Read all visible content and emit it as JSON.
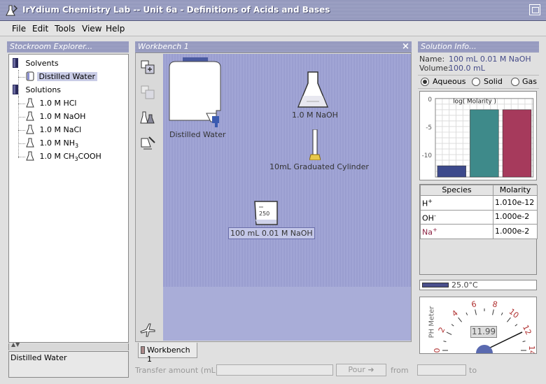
{
  "window": {
    "title": "IrYdium Chemistry Lab -- Unit 6a - Definitions of Acids and Bases"
  },
  "menu": {
    "file": "File",
    "edit": "Edit",
    "tools": "Tools",
    "view": "View",
    "help": "Help"
  },
  "explorer": {
    "header": "Stockroom Explorer...",
    "solvents_label": "Solvents",
    "distilled_water": "Distilled Water",
    "solutions_label": "Solutions",
    "solution_items": [
      "1.0 M HCl",
      "1.0 M NaOH",
      "1.0 M NaCl"
    ],
    "nh3_prefix": "1.0 M NH",
    "nh3_sub": "3",
    "acetic_prefix": "1.0 M CH",
    "acetic_sub": "3",
    "acetic_suffix": "COOH",
    "selected_description": "Distilled Water"
  },
  "workbench": {
    "header": "Workbench 1",
    "close": "×",
    "items": {
      "water_label": "Distilled Water",
      "flask_label": "1.0 M NaOH",
      "cylinder_label": "10mL Graduated Cylinder",
      "beaker_label": "100 mL 0.01 M NaOH",
      "beaker_volume_mark": "250"
    },
    "tab_label": "Workbench 1"
  },
  "transfer": {
    "amount_label": "Transfer amount (mL):",
    "pour_label": "Pour",
    "from_label": "from",
    "to_label": "to"
  },
  "solution_info": {
    "header": "Solution Info...",
    "name_label": "Name:",
    "name_value": "100 mL 0.01 M NaOH",
    "volume_label": "Volume:",
    "volume_value": "100.0 mL",
    "phase_options": [
      "Aqueous",
      "Solid",
      "Gas"
    ],
    "selected_phase": "Aqueous"
  },
  "chart_data": {
    "type": "bar",
    "title": "log( Molarity )",
    "categories": [
      "H+",
      "OH-",
      "Na+"
    ],
    "values": [
      -12.0,
      -2.0,
      -2.0
    ],
    "ylim": [
      -14,
      0
    ],
    "yticks": [
      0,
      -5,
      -10
    ],
    "colors": [
      "#3d4a8c",
      "#3e8a8a",
      "#a63a5c"
    ]
  },
  "species_table": {
    "headers": [
      "Species",
      "Molarity"
    ],
    "rows": [
      {
        "species": "H",
        "sup": "+",
        "molarity": "1.010e-12"
      },
      {
        "species": "OH",
        "sup": "-",
        "molarity": "1.000e-2"
      },
      {
        "species": "Na",
        "sup": "+",
        "molarity": "1.000e-2"
      }
    ]
  },
  "temperature": {
    "value": "25.0°C"
  },
  "ph_meter": {
    "label": "PH Meter",
    "reading": "11.99",
    "ticks": [
      "0",
      "2",
      "4",
      "6",
      "8",
      "10",
      "12",
      "14"
    ],
    "ph_value": 11.99
  }
}
